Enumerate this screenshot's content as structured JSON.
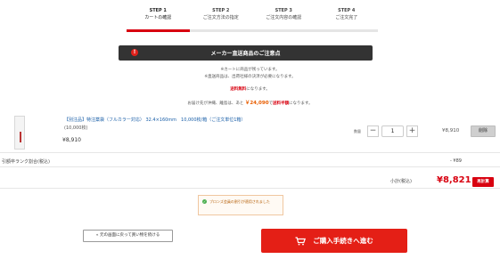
{
  "steps": [
    {
      "num": "STEP 1",
      "label": "カートの確認",
      "active": true
    },
    {
      "num": "STEP 2",
      "label": "ご注文方法の指定",
      "active": false
    },
    {
      "num": "STEP 3",
      "label": "ご注文内容の確認",
      "active": false
    },
    {
      "num": "STEP 4",
      "label": "ご注文完了",
      "active": false
    }
  ],
  "notice": {
    "title": "メーカー直送商品のご注意点",
    "icon": "warning-icon",
    "line1": "※カートに商品が残っています。",
    "line2": "※直送商品は、出荷社様の決済が必要になります。",
    "free_shipping": "送料無料",
    "free_shipping_suffix": "になります。",
    "line4_prefix": "お届け先が沖縄、離島は、あと",
    "line4_amount": "￥24,090",
    "line4_middle": "で",
    "line4_free": "送料半額",
    "line4_suffix": "になります。"
  },
  "item": {
    "name": "【別注品】特注薬袋（フルカラー対応） 32.4×160mm　10,000枚/箱（ご注文単位1箱）",
    "unit": "(10,000枚)",
    "price": "¥8,910",
    "qty_label": "数量",
    "qty_minus": "−",
    "qty_value": "1",
    "qty_plus": "+",
    "line_total": "¥8,910",
    "delete_label": "削除"
  },
  "discount": {
    "label": "引額卒ランク割合(税込)",
    "value": "- ¥89"
  },
  "subtotal": {
    "label": "小計(税込)",
    "value": "¥8,821",
    "recalc_label": "再計算"
  },
  "bronze_note": {
    "text": "ブロンズ会員の割引が適用されました"
  },
  "actions": {
    "back_label": "« 元の画面に戻って買い物を続ける",
    "proceed_label": "ご購入手続きへ進む"
  },
  "colors": {
    "accent_red": "#d8000f",
    "button_red": "#e41f16",
    "notice_dark": "#333333",
    "link_blue": "#1a5fa8"
  }
}
